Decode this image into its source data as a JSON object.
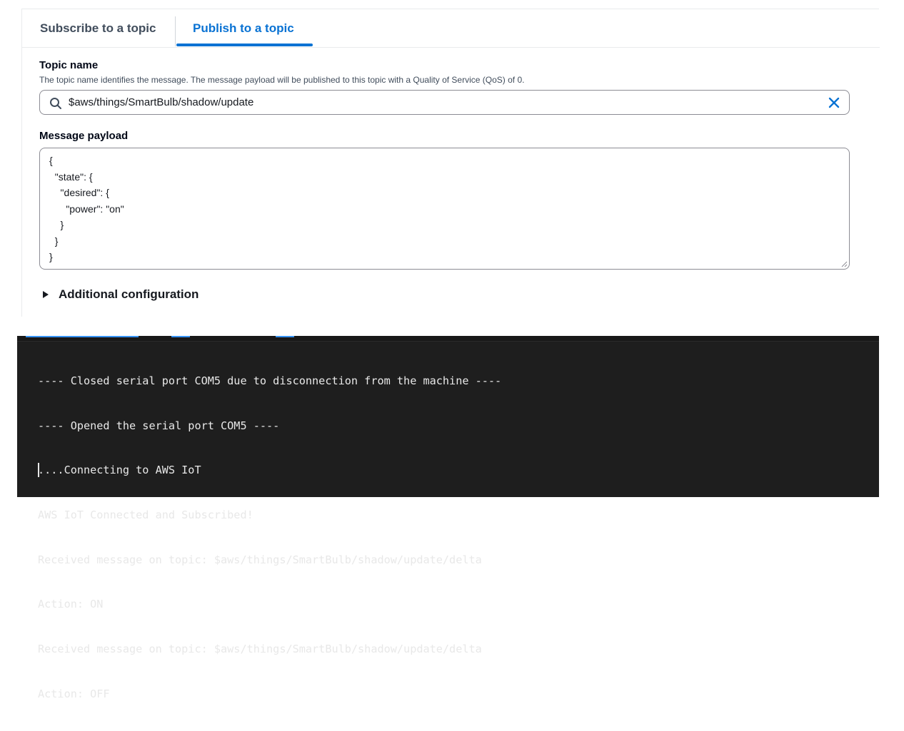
{
  "tabs": [
    {
      "label": "Subscribe to a topic",
      "active": false
    },
    {
      "label": "Publish to a topic",
      "active": true
    }
  ],
  "topic": {
    "label": "Topic name",
    "description": "The topic name identifies the message. The message payload will be published to this topic with a Quality of Service (QoS) of 0.",
    "value": "$aws/things/SmartBulb/shadow/update",
    "search_icon": "search-icon",
    "clear_icon": "close-icon"
  },
  "payload": {
    "label": "Message payload",
    "value": "{\n  \"state\": {\n    \"desired\": {\n      \"power\": \"on\"\n    }\n  }\n}"
  },
  "additional_config": {
    "label": "Additional configuration",
    "icon": "caret-right-icon"
  },
  "terminal": {
    "lines": [
      "---- Closed serial port COM5 due to disconnection from the machine ----",
      "---- Opened the serial port COM5 ----",
      "....Connecting to AWS IoT",
      "AWS IoT Connected and Subscribed!",
      "Received message on topic: $aws/things/SmartBulb/shadow/update/delta",
      "Action: ON",
      "Received message on topic: $aws/things/SmartBulb/shadow/update/delta",
      "Action: OFF"
    ]
  },
  "colors": {
    "accent": "#0972d3",
    "terminal_bg": "#1e1e1e",
    "terminal_text": "#e8e8e8"
  }
}
